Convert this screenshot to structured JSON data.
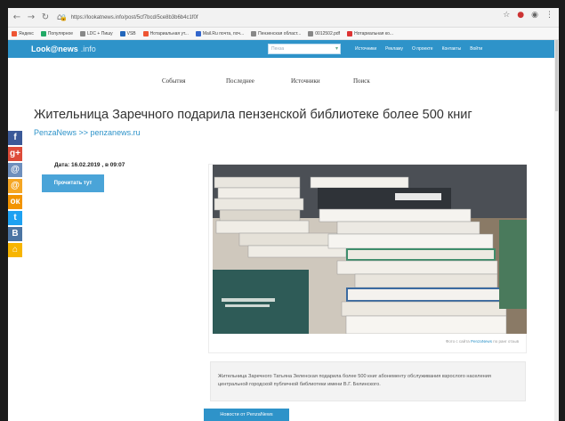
{
  "browser": {
    "url": "https://lookatnews.info/post/5cf7bcd/5ce8b3b6b4c1f0f",
    "back_icon": "arrow-left-icon",
    "bookmarks": [
      {
        "label": "Яндекс",
        "color": "#e53"
      },
      {
        "label": "Популярное",
        "color": "#2a6"
      },
      {
        "label": "LDC + Пишу",
        "color": "#888"
      },
      {
        "label": "VSB",
        "color": "#26b"
      },
      {
        "label": "Нотариальная ут...",
        "color": "#e53"
      },
      {
        "label": "Mail.Ru почта, поч...",
        "color": "#36c"
      },
      {
        "label": "Пензенская област...",
        "color": "#888"
      },
      {
        "label": "0012502.pdf",
        "color": "#888"
      },
      {
        "label": "Нотариальная ко...",
        "color": "#d33"
      }
    ]
  },
  "site": {
    "logo": "Look@news",
    "logo_suffix": ".info",
    "search_placeholder": "Пенза",
    "top_links": [
      "Источники",
      "Рекламу",
      "О проекте",
      "Контакты",
      "Войти"
    ],
    "menu": [
      "События",
      "Последнее",
      "Источники",
      "Поиск"
    ]
  },
  "article": {
    "title": "Жительница Заречного подарила пензенской библиотеке более 500 книг",
    "source": "PenzaNews >> penzanews.ru",
    "date": "Дата: 16.02.2019 , в 09:07",
    "read_button": "Прочитать тут",
    "photo_caption_prefix": "Фото с сайта",
    "photo_caption_link": "PenzaNews",
    "photo_caption_suffix": "по ранг отзыв",
    "description": "Жительница Заречного Татьяна Зеленская подарила более 500 книг абонементу обслуживания взрослого населения центральной городской публичной библиотеки имени В.Г. Белинского.",
    "news_button": "Новости от PenzaNews"
  },
  "social": [
    {
      "icon": "facebook-icon",
      "glyph": "f",
      "color": "#3b5998"
    },
    {
      "icon": "google-plus-icon",
      "glyph": "g+",
      "color": "#dd4b39"
    },
    {
      "icon": "myworld-icon",
      "glyph": "@",
      "color": "#6e8fbd"
    },
    {
      "icon": "mail-icon",
      "glyph": "@",
      "color": "#f5a623"
    },
    {
      "icon": "odnoklassniki-icon",
      "glyph": "ок",
      "color": "#f29400"
    },
    {
      "icon": "twitter-icon",
      "glyph": "t",
      "color": "#1da1f2"
    },
    {
      "icon": "vk-icon",
      "glyph": "В",
      "color": "#4c75a3"
    },
    {
      "icon": "home-icon",
      "glyph": "⌂",
      "color": "#f7b500"
    }
  ],
  "colors": {
    "accent": "#2e93c9",
    "button": "#4aa4d8"
  }
}
